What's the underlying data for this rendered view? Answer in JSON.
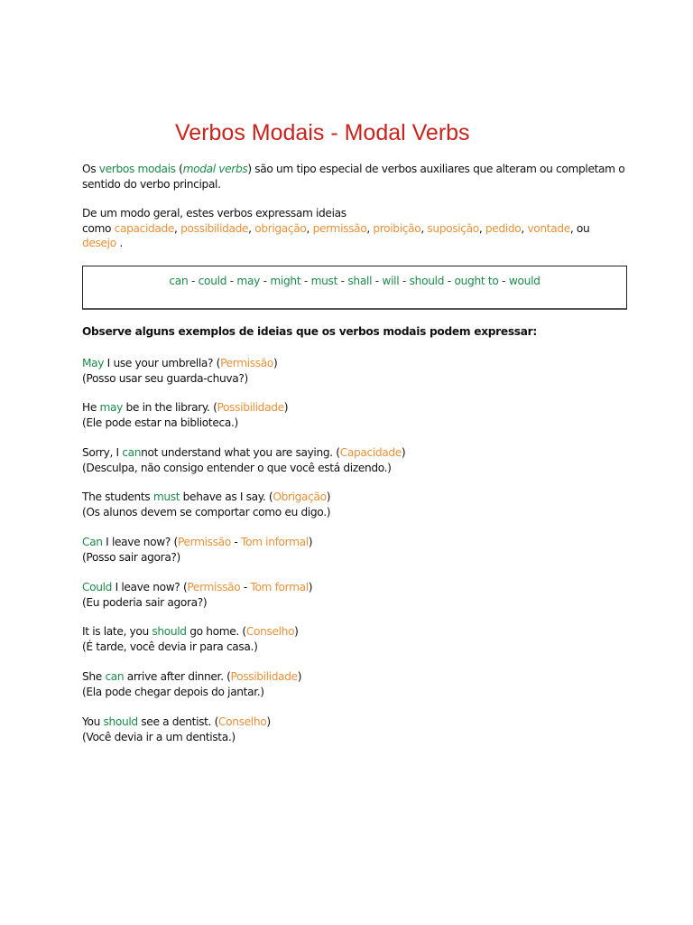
{
  "title": "Verbos Modais - Modal Verbs",
  "colors": {
    "title": "#c8241c",
    "green": "#1e8a4a",
    "orange": "#e8913a",
    "text": "#111111"
  },
  "intro": {
    "p1_a": "Os ",
    "p1_green": "verbos modais",
    "p1_b": " (",
    "p1_italic": "modal verbs",
    "p1_c": ") são um tipo especial de verbos auxiliares que alteram ou completam o",
    "p1_line2": "sentido do verbo principal."
  },
  "ideas": {
    "line1": "De um modo geral, estes verbos expressam ideias",
    "prefix": "como ",
    "items": [
      "capacidade",
      "possibilidade",
      "obrigação",
      "permissão",
      "proibição",
      "suposição",
      "pedido",
      "vontade"
    ],
    "conj": ", ou",
    "last": "desejo",
    "end": " ."
  },
  "modal_list": {
    "verbs": [
      "can",
      "could",
      "may",
      "might",
      "must",
      "shall",
      "will",
      "should",
      "ought to",
      "would"
    ],
    "separator": " - "
  },
  "examples_heading": "Observe alguns exemplos de ideias que os verbos modais podem expressar:",
  "examples": [
    {
      "pre": "",
      "modal": "May",
      "post": " I use your umbrella? (",
      "idea": "Permissão",
      "idea_sep": "",
      "idea2": "",
      "close": ")",
      "translation": "(Posso usar seu guarda-chuva?)"
    },
    {
      "pre": "He ",
      "modal": "may",
      "post": " be in the library. (",
      "idea": "Possibilidade",
      "idea_sep": "",
      "idea2": "",
      "close": ")",
      "translation": "(Ele pode estar na biblioteca.)"
    },
    {
      "pre": "Sorry, I ",
      "modal": "can",
      "post": "not understand what you are saying. (",
      "idea": "Capacidade",
      "idea_sep": "",
      "idea2": "",
      "close": ")",
      "translation": "(Desculpa, não consigo entender o que você está dizendo.)"
    },
    {
      "pre": "The students ",
      "modal": "must",
      "post": " behave as I say. (",
      "idea": "Obrigação",
      "idea_sep": "",
      "idea2": "",
      "close": ")",
      "translation": "(Os alunos devem se comportar como eu digo.)"
    },
    {
      "pre": "",
      "modal": "Can",
      "post": " I leave now? (",
      "idea": "Permissão",
      "idea_sep": " - ",
      "idea2": "Tom informal",
      "close": ")",
      "translation": "(Posso sair agora?)"
    },
    {
      "pre": "",
      "modal": "Could",
      "post": " I leave now? (",
      "idea": "Permissão",
      "idea_sep": " - ",
      "idea2": "Tom formal",
      "close": ")",
      "translation": "(Eu poderia sair agora?)"
    },
    {
      "pre": "It is late, you ",
      "modal": "should",
      "post": " go home. (",
      "idea": "Conselho",
      "idea_sep": "",
      "idea2": "",
      "close": ")",
      "translation": "(É tarde, você devia ir para casa.)"
    },
    {
      "pre": "She ",
      "modal": "can",
      "post": " arrive after dinner. (",
      "idea": "Possibilidade",
      "idea_sep": "",
      "idea2": "",
      "close": ")",
      "translation": "(Ela pode chegar depois do jantar.)"
    },
    {
      "pre": "You ",
      "modal": "should",
      "post": " see a dentist. (",
      "idea": "Conselho",
      "idea_sep": "",
      "idea2": "",
      "close": ")",
      "translation": "(Você devia ir a um dentista.)"
    }
  ]
}
